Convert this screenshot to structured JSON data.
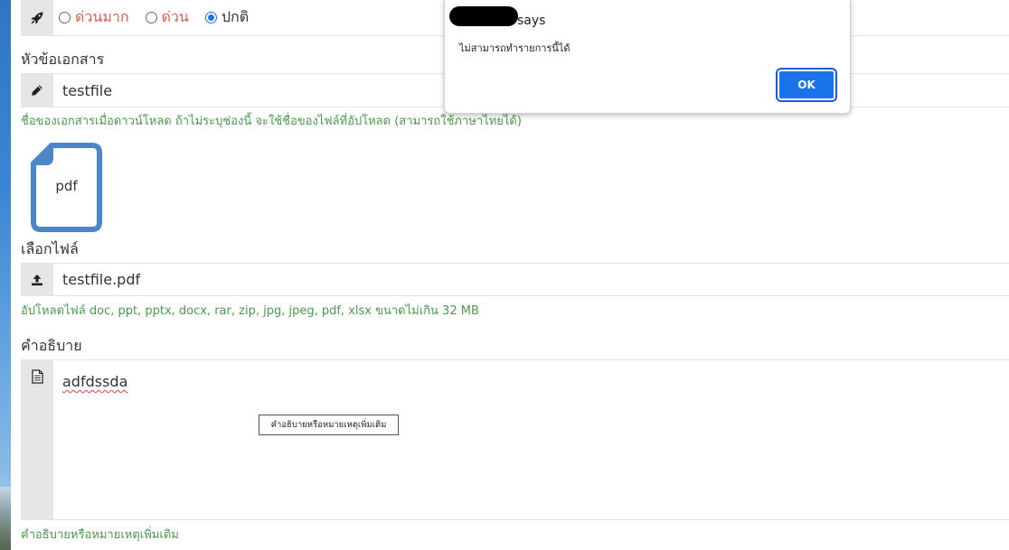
{
  "priority": {
    "options": [
      {
        "label": "ด่วนมาก",
        "checked": false,
        "color": "#e05a4a"
      },
      {
        "label": "ด่วน",
        "checked": false,
        "color": "#e05a4a"
      },
      {
        "label": "ปกติ",
        "checked": true,
        "color": "#333333"
      }
    ],
    "icon": "rocket-icon"
  },
  "subject": {
    "label": "หัวข้อเอกสาร",
    "value": "testfile",
    "help": "ชื่อของเอกสารเมื่อดาวน์โหลด ถ้าไม่ระบุช่องนี้ จะใช้ชื่อของไฟล์ที่อัปโหลด (สามารถใช้ภาษาไทยได้)",
    "icon": "pencil-icon"
  },
  "file": {
    "preview_type": "pdf",
    "label": "เลือกไฟล์",
    "value": "testfile.pdf",
    "help": "อัปโหลดไฟล์ doc, ppt, pptx, docx, rar, zip, jpg, jpeg, pdf, xlsx ขนาดไม่เกิน 32 MB",
    "icon": "upload-icon"
  },
  "description": {
    "label": "คำอธิบาย",
    "value": "adfdssda",
    "tooltip": "คำอธิบายหรือหมายเหตุเพิ่มเติม",
    "help": "คำอธิบายหรือหมายเหตุเพิ่มเติม",
    "icon": "document-icon"
  },
  "dialog": {
    "says": "says",
    "message": "ไม่สามารถทำรายการนี้ได้",
    "ok_label": "OK",
    "accent": "#1a73e8"
  },
  "colors": {
    "help_green": "#4a9a4a",
    "urgent_red": "#e05a4a",
    "pdf_icon_blue": "#4a86c8"
  }
}
